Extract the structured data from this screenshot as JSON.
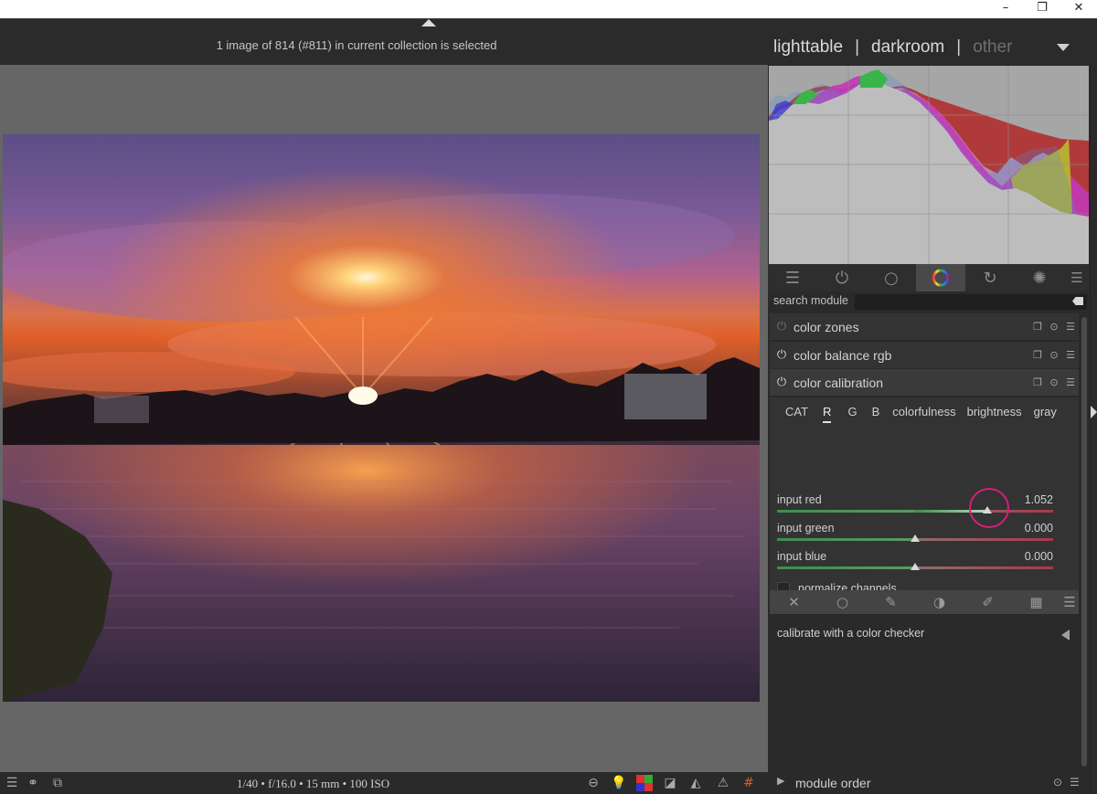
{
  "window": {
    "minimize_glyph": "–",
    "restore_glyph": "❐",
    "close_glyph": "✕"
  },
  "top_panel": {
    "info": "1 image of 814 (#811) in current collection is selected",
    "views": [
      "lighttable",
      "darkroom",
      "other"
    ],
    "separator": "|"
  },
  "right_panel": {
    "group_tabs": [
      {
        "icon": "sliders-icon",
        "glyph": "☰",
        "active": false
      },
      {
        "icon": "power-icon",
        "glyph": "⏻",
        "active": false
      },
      {
        "icon": "circle-icon",
        "glyph": "○",
        "active": false
      },
      {
        "icon": "color-wheel-icon",
        "glyph": "",
        "active": true
      },
      {
        "icon": "rotate-icon",
        "glyph": "↻",
        "active": false
      },
      {
        "icon": "aperture-icon",
        "glyph": "✺",
        "active": false
      }
    ],
    "search": {
      "label": "search module",
      "value": ""
    },
    "modules": [
      {
        "name": "color zones",
        "enabled": false
      },
      {
        "name": "color balance rgb",
        "enabled": true
      },
      {
        "name": "color calibration",
        "enabled": true
      }
    ],
    "color_calibration": {
      "tabs": [
        "CAT",
        "R",
        "G",
        "B",
        "colorfulness",
        "brightness",
        "gray"
      ],
      "active_tab": "R",
      "sliders": [
        {
          "label": "input red",
          "value": "1.052",
          "position": 0.76
        },
        {
          "label": "input green",
          "value": "0.000",
          "position": 0.5
        },
        {
          "label": "input blue",
          "value": "0.000",
          "position": 0.5
        }
      ],
      "normalize_label": "normalize channels",
      "normalize_checked": false,
      "calibrate_label": "calibrate with a color checker"
    },
    "mask_bar": [
      {
        "icon": "mask-off-icon",
        "glyph": "✕"
      },
      {
        "icon": "uniform-mask-icon",
        "glyph": "○"
      },
      {
        "icon": "drawn-mask-icon",
        "glyph": "✎"
      },
      {
        "icon": "parametric-mask-icon",
        "glyph": "◑"
      },
      {
        "icon": "drawn-parametric-mask-icon",
        "glyph": "✐"
      },
      {
        "icon": "raster-mask-icon",
        "glyph": "▦"
      }
    ],
    "module_order_label": "module order"
  },
  "bottom_panel": {
    "exif": "1/40 • f/16.0 • 15 mm • 100 ISO"
  },
  "colors": {
    "panel_bg": "#2a2a2a",
    "center_bg": "#666666",
    "highlight_circle": "#d61e7a",
    "slider_green": "#3c8f4d",
    "slider_red": "#a83a4a"
  }
}
